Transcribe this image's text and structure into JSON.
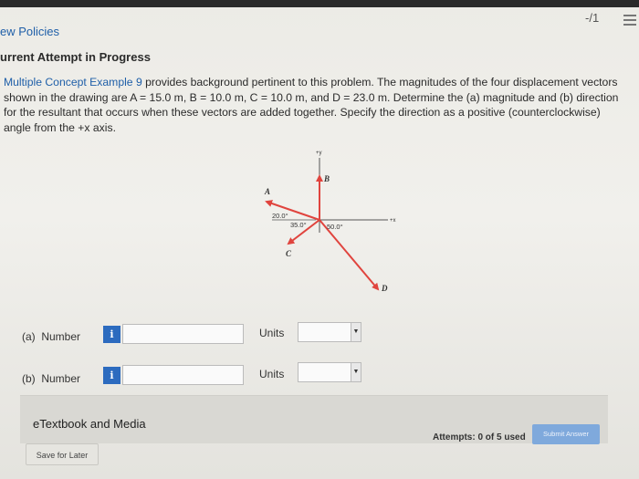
{
  "header": {
    "score": "-/1",
    "policies_link": "ew Policies",
    "attempt_title": "urrent Attempt in Progress"
  },
  "problem": {
    "link_text": "Multiple Concept Example 9",
    "text": " provides background pertinent to this problem. The magnitudes of the four displacement vectors shown in the drawing are A = 15.0 m, B = 10.0 m, C = 10.0 m, and D = 23.0 m. Determine the (a) magnitude and (b) direction for the resultant that occurs when these vectors are added together. Specify the direction as a positive (counterclockwise) angle from the +x axis."
  },
  "diagram": {
    "axis_y_label": "+y",
    "axis_x_label": "+x",
    "vector_labels": {
      "A": "A",
      "B": "B",
      "C": "C",
      "D": "D"
    },
    "angle_a": "20.0°",
    "angle_c": "35.0°",
    "angle_d": "50.0°",
    "vector_color": "#e0443e"
  },
  "answers": [
    {
      "part": "(a)",
      "label": "Number",
      "info": "i",
      "value": "",
      "units_label": "Units",
      "units_value": ""
    },
    {
      "part": "(b)",
      "label": "Number",
      "info": "i",
      "value": "",
      "units_label": "Units",
      "units_value": ""
    }
  ],
  "footer": {
    "etextbook": "eTextbook and Media",
    "save_label": "Save for Later",
    "attempts": "Attempts: 0 of 5 used",
    "submit_label": "Submit Answer"
  }
}
